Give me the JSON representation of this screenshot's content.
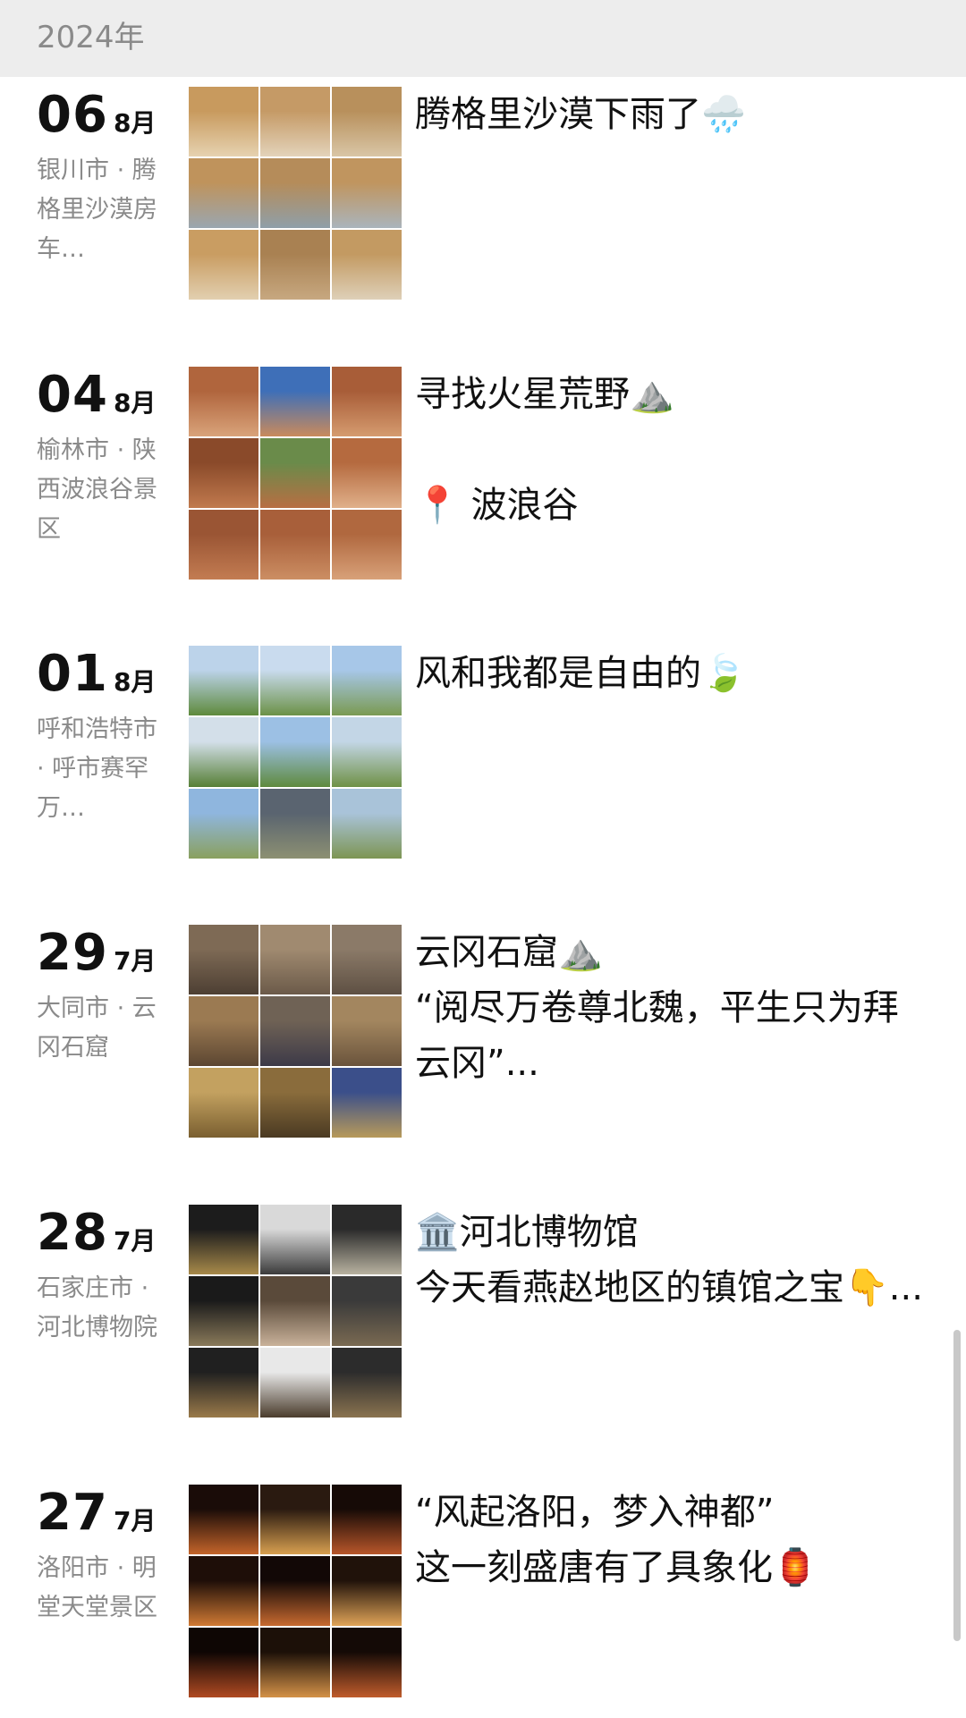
{
  "header": {
    "year": "2024年"
  },
  "posts": [
    {
      "day": "06",
      "month": "8月",
      "location": "银川市 · 腾格里沙漠房车…",
      "caption": "腾格里沙漠下雨了🌧️",
      "tiles": [
        [
          "#c89a5e",
          "#e6d2b0"
        ],
        [
          "#c59a66",
          "#e3d3ba"
        ],
        [
          "#b8905c",
          "#d9c6a6"
        ],
        [
          "#bf935c",
          "#9aa6b0"
        ],
        [
          "#b58c5a",
          "#8f9fa9"
        ],
        [
          "#c0955f",
          "#aab4bc"
        ],
        [
          "#c99d62",
          "#e2cfb0"
        ],
        [
          "#a98152",
          "#c7a880"
        ],
        [
          "#c39a62",
          "#ded0b8"
        ]
      ]
    },
    {
      "day": "04",
      "month": "8月",
      "location": "榆林市 · 陕西波浪谷景区",
      "caption": "寻找火星荒野⛰️\n\n📍 波浪谷",
      "tiles": [
        [
          "#b0653d",
          "#d9a37a"
        ],
        [
          "#3e6fb8",
          "#c98a5c"
        ],
        [
          "#a85d38",
          "#d59b6f"
        ],
        [
          "#8a4a2a",
          "#c17a4e"
        ],
        [
          "#6a8b4a",
          "#b86e43"
        ],
        [
          "#b56a3f",
          "#e0b08a"
        ],
        [
          "#9a5534",
          "#c37c52"
        ],
        [
          "#a85f3a",
          "#cc8e63"
        ],
        [
          "#b0683f",
          "#d8a179"
        ]
      ]
    },
    {
      "day": "01",
      "month": "8月",
      "location": "呼和浩特市 · 呼市赛罕万…",
      "caption": "风和我都是自由的🍃",
      "tiles": [
        [
          "#bcd3ea",
          "#5e8a3c"
        ],
        [
          "#c9dbee",
          "#6b9147"
        ],
        [
          "#a7c7e8",
          "#7a9a52"
        ],
        [
          "#d3dfe9",
          "#567f36"
        ],
        [
          "#9cc0e4",
          "#5f8a3e"
        ],
        [
          "#c3d6e6",
          "#6f9146"
        ],
        [
          "#8fb6de",
          "#8aa05e"
        ],
        [
          "#5a6470",
          "#8c9072"
        ],
        [
          "#a9c3d9",
          "#7d9553"
        ]
      ]
    },
    {
      "day": "29",
      "month": "7月",
      "location": "大同市 · 云冈石窟",
      "caption": "云冈石窟⛰️\n“阅尽万卷尊北魏，平生只为拜云冈”...",
      "tiles": [
        [
          "#7e6a55",
          "#4d3f33"
        ],
        [
          "#a08a70",
          "#6b5a49"
        ],
        [
          "#8b7a68",
          "#5e5043"
        ],
        [
          "#9b7a52",
          "#5c4632"
        ],
        [
          "#6f6255",
          "#3d3a48"
        ],
        [
          "#a3865f",
          "#6a543c"
        ],
        [
          "#c3a160",
          "#7a5f30"
        ],
        [
          "#8a6c3c",
          "#4a3a22"
        ],
        [
          "#3b4f8a",
          "#b89a5a"
        ]
      ]
    },
    {
      "day": "28",
      "month": "7月",
      "location": "石家庄市 · 河北博物院",
      "caption": "🏛️河北博物馆\n今天看燕赵地区的镇馆之宝👇...",
      "tiles": [
        [
          "#1c1c1c",
          "#a88a4a"
        ],
        [
          "#d9d9d9",
          "#3b3b3b"
        ],
        [
          "#2a2a2a",
          "#b8b2a0"
        ],
        [
          "#1a1a1a",
          "#8a7a5a"
        ],
        [
          "#5a4a3a",
          "#c9b29a"
        ],
        [
          "#3a3a3a",
          "#7a6a52"
        ],
        [
          "#202020",
          "#9a7a4a"
        ],
        [
          "#e8e8e8",
          "#4a3c2c"
        ],
        [
          "#2c2c2c",
          "#8a7350"
        ]
      ]
    },
    {
      "day": "27",
      "month": "7月",
      "location": "洛阳市 · 明堂天堂景区",
      "caption": "“风起洛阳，梦入神都”\n这一刻盛唐有了具象化🏮",
      "tiles": [
        [
          "#1a0c08",
          "#c4642a"
        ],
        [
          "#2a1a10",
          "#d8a050"
        ],
        [
          "#160a06",
          "#b8562a"
        ],
        [
          "#1e0e08",
          "#d07a34"
        ],
        [
          "#120806",
          "#c86a30"
        ],
        [
          "#20120a",
          "#e0a458"
        ],
        [
          "#0e0604",
          "#b04a22"
        ],
        [
          "#1c1008",
          "#d49248"
        ],
        [
          "#140a06",
          "#c05c2c"
        ]
      ]
    }
  ]
}
